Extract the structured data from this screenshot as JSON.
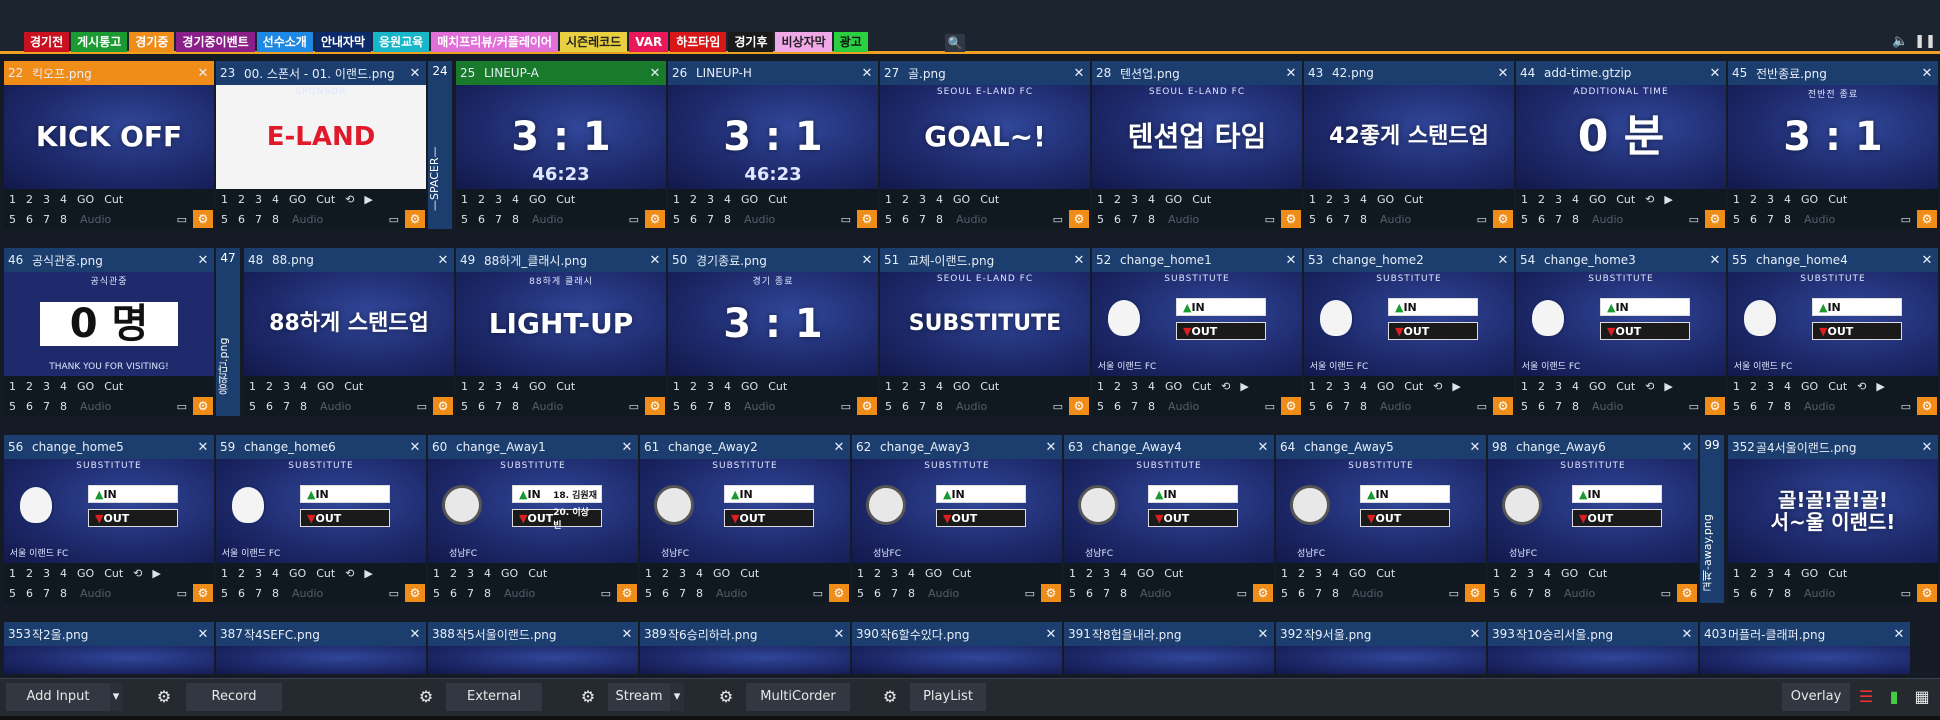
{
  "tabs": [
    {
      "label": "경기전",
      "bg": "#c8101e",
      "fg": "#fff"
    },
    {
      "label": "게시통고",
      "bg": "#1a9a30",
      "fg": "#fff"
    },
    {
      "label": "경기중",
      "bg": "#f08c18",
      "fg": "#fff"
    },
    {
      "label": "경기중이벤트",
      "bg": "#8a1f8a",
      "fg": "#fff"
    },
    {
      "label": "선수소개",
      "bg": "#1e88e5",
      "fg": "#fff"
    },
    {
      "label": "안내자막",
      "bg": "#0b2a6a",
      "fg": "#fff"
    },
    {
      "label": "응원교육",
      "bg": "#17b6c8",
      "fg": "#fff"
    },
    {
      "label": "매치프리뷰/커플레이어",
      "bg": "#e070d8",
      "fg": "#fff"
    },
    {
      "label": "시즌레코드",
      "bg": "#e8d040",
      "fg": "#222"
    },
    {
      "label": "VAR",
      "bg": "#e8185a",
      "fg": "#fff"
    },
    {
      "label": "하프타임",
      "bg": "#d81818",
      "fg": "#fff"
    },
    {
      "label": "경기후",
      "bg": "#1a1a1a",
      "fg": "#fff"
    },
    {
      "label": "비상자막",
      "bg": "#f0a8e8",
      "fg": "#222"
    },
    {
      "label": "광고",
      "bg": "#2ad040",
      "fg": "#111"
    }
  ],
  "row1": [
    {
      "num": "22",
      "title": "킥오프.png",
      "art": "KICK OFF"
    },
    {
      "num": "23",
      "title": "00. 스폰서 - 01. 이랜드.png",
      "art": "E-LAND",
      "sub": "SPONSOR"
    },
    {
      "num": "25",
      "title": "LINEUP-A",
      "art": "3 : 1",
      "art2": "46:23"
    },
    {
      "num": "26",
      "title": "LINEUP-H",
      "art": "3 : 1",
      "art2": "46:23"
    },
    {
      "num": "27",
      "title": "골.png",
      "art": "GOAL~!",
      "sub": "SEOUL E-LAND FC"
    },
    {
      "num": "28",
      "title": "텐션업.png",
      "art": "텐션업 타임",
      "sub": "SEOUL E-LAND FC"
    },
    {
      "num": "43",
      "title": "42.png",
      "art": "42좋게 스탠드업"
    },
    {
      "num": "44",
      "title": "add-time.gtzip",
      "art": "0 분",
      "sub": "ADDITIONAL TIME"
    },
    {
      "num": "45",
      "title": "전반종료.png",
      "art": "3 : 1",
      "sub": "전반전 종료"
    }
  ],
  "spacer1": {
    "num": "24",
    "label": "—SPACER—"
  },
  "row2": [
    {
      "num": "46",
      "title": "공식관중.png",
      "art": "0 명",
      "sub": "공식관중",
      "foot": "THANK YOU FOR VISITING!"
    },
    {
      "num": "48",
      "title": "88.png",
      "art": "88하게 스탠드업"
    },
    {
      "num": "49",
      "title": "88하게_클래시.png",
      "art": "LIGHT-UP",
      "sub": "88하게 클래시"
    },
    {
      "num": "50",
      "title": "경기종료.png",
      "art": "3 : 1",
      "sub": "경기 종료"
    },
    {
      "num": "51",
      "title": "교체-이랜드.png",
      "art": "SUBSTITUTE",
      "sub": "SEOUL E-LAND FC"
    },
    {
      "num": "52",
      "title": "change_home1",
      "art": "sub"
    },
    {
      "num": "53",
      "title": "change_home2",
      "art": "sub"
    },
    {
      "num": "54",
      "title": "change_home3",
      "art": "sub"
    },
    {
      "num": "55",
      "title": "change_home4",
      "art": "sub"
    }
  ],
  "spacer2": {
    "num": "47",
    "label": "응원단.png"
  },
  "row3": [
    {
      "num": "56",
      "title": "change_home5",
      "art": "sub"
    },
    {
      "num": "59",
      "title": "change_home6",
      "art": "sub"
    },
    {
      "num": "60",
      "title": "change_Away1",
      "art": "sub-away",
      "in_name": "18. 김원재",
      "out_name": "20. 이상빈"
    },
    {
      "num": "61",
      "title": "change_Away2",
      "art": "sub-away"
    },
    {
      "num": "62",
      "title": "change_Away3",
      "art": "sub-away"
    },
    {
      "num": "63",
      "title": "change_Away4",
      "art": "sub-away"
    },
    {
      "num": "64",
      "title": "change_Away5",
      "art": "sub-away"
    },
    {
      "num": "98",
      "title": "change_Away6",
      "art": "sub-away"
    },
    {
      "num": "352",
      "title": "골4서울이랜드.png",
      "art": "골!골!골!골!\n서~울 이랜드!"
    }
  ],
  "spacer3": {
    "num": "99",
    "label": "교체-away.png"
  },
  "row4": [
    {
      "num": "353",
      "title": "작2울.png"
    },
    {
      "num": "387",
      "title": "작4SEFC.png"
    },
    {
      "num": "388",
      "title": "작5서울이랜드.png"
    },
    {
      "num": "389",
      "title": "작6승리하라.png"
    },
    {
      "num": "390",
      "title": "작6할수있다.png"
    },
    {
      "num": "391",
      "title": "작8헙을내라.png"
    },
    {
      "num": "392",
      "title": "작9서울.png"
    },
    {
      "num": "393",
      "title": "작10승리서울.png"
    },
    {
      "num": "403",
      "title": "머플러-클래퍼.png"
    }
  ],
  "controls": {
    "n1": "1",
    "n2": "2",
    "n3": "3",
    "n4": "4",
    "go": "GO",
    "cut": "Cut",
    "n5": "5",
    "n6": "6",
    "n7": "7",
    "n8": "8",
    "audio": "Audio"
  },
  "sub_labels": {
    "in": "IN",
    "out": "OUT",
    "banner": "SUBSTITUTE",
    "home_team": "서울 이랜드 FC",
    "away_team": "성남FC"
  },
  "bottom": {
    "add_input": "Add Input",
    "record": "Record",
    "external": "External",
    "stream": "Stream",
    "multicorder": "MultiCorder",
    "playlist": "PlayList",
    "overlay": "Overlay"
  }
}
